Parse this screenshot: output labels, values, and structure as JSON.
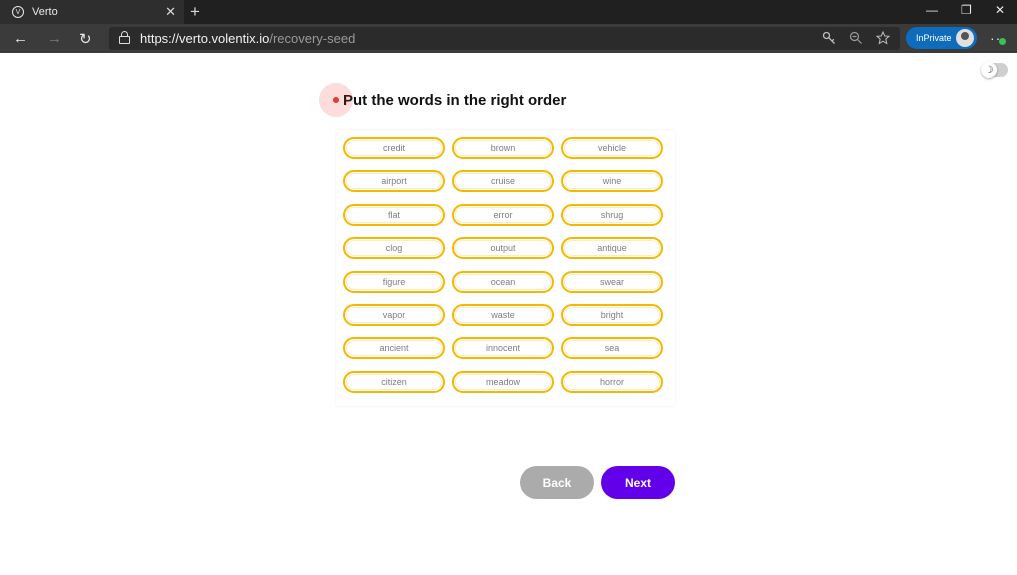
{
  "browser": {
    "tab_title": "Verto",
    "tab_close": "✕",
    "new_tab": "+",
    "window_controls": {
      "minimize": "—",
      "restore": "❐",
      "close": "✕"
    },
    "nav": {
      "back": "←",
      "forward": "→",
      "refresh": "↻"
    },
    "url_host": "https://verto.volentix.io",
    "url_path": "/recovery-seed",
    "inprivate_label": "InPrivate",
    "more": "···"
  },
  "page": {
    "title": "Put the words in the right order",
    "words": [
      "credit",
      "brown",
      "vehicle",
      "airport",
      "cruise",
      "wine",
      "flat",
      "error",
      "shrug",
      "clog",
      "output",
      "antique",
      "figure",
      "ocean",
      "swear",
      "vapor",
      "waste",
      "bright",
      "ancient",
      "innocent",
      "sea",
      "citizen",
      "meadow",
      "horror"
    ],
    "back_label": "Back",
    "next_label": "Next",
    "accent_color": "#6200ea",
    "chip_border_color": "#f5b800"
  }
}
